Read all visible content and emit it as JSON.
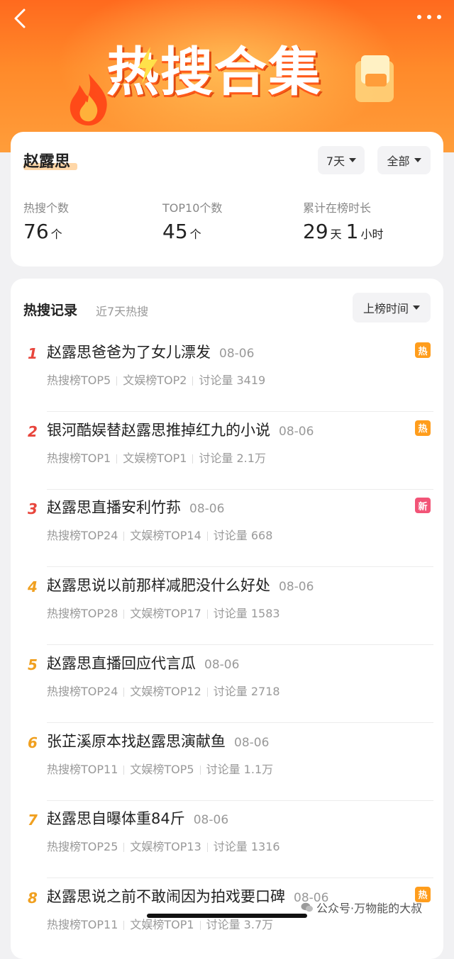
{
  "banner": {
    "title": "热搜合集"
  },
  "summary": {
    "name": "赵露思",
    "period_filter": "7天",
    "category_filter": "全部",
    "stats": [
      {
        "label": "热搜个数",
        "value": "76",
        "unit": "个"
      },
      {
        "label": "TOP10个数",
        "value": "45",
        "unit": "个"
      },
      {
        "label": "累计在榜时长",
        "value_days": "29",
        "unit_days": "天",
        "value_hours": "1",
        "unit_hours": "小时"
      }
    ]
  },
  "records": {
    "title": "热搜记录",
    "subtitle": "近7天热搜",
    "sort_label": "上榜时间",
    "items": [
      {
        "rank": "1",
        "title": "赵露思爸爸为了女儿漂发",
        "date": "08-06",
        "rank1": "热搜榜TOP5",
        "rank2": "文娱榜TOP2",
        "discussion": "讨论量 3419",
        "badge": "热"
      },
      {
        "rank": "2",
        "title": "银河酷娱替赵露思推掉红九的小说",
        "date": "08-06",
        "rank1": "热搜榜TOP1",
        "rank2": "文娱榜TOP1",
        "discussion": "讨论量 2.1万",
        "badge": "热"
      },
      {
        "rank": "3",
        "title": "赵露思直播安利竹荪",
        "date": "08-06",
        "rank1": "热搜榜TOP24",
        "rank2": "文娱榜TOP14",
        "discussion": "讨论量 668",
        "badge": "新"
      },
      {
        "rank": "4",
        "title": "赵露思说以前那样减肥没什么好处",
        "date": "08-06",
        "rank1": "热搜榜TOP28",
        "rank2": "文娱榜TOP17",
        "discussion": "讨论量 1583",
        "badge": ""
      },
      {
        "rank": "5",
        "title": "赵露思直播回应代言瓜",
        "date": "08-06",
        "rank1": "热搜榜TOP24",
        "rank2": "文娱榜TOP12",
        "discussion": "讨论量 2718",
        "badge": ""
      },
      {
        "rank": "6",
        "title": "张芷溪原本找赵露思演献鱼",
        "date": "08-06",
        "rank1": "热搜榜TOP11",
        "rank2": "文娱榜TOP5",
        "discussion": "讨论量 1.1万",
        "badge": ""
      },
      {
        "rank": "7",
        "title": "赵露思自曝体重84斤",
        "date": "08-06",
        "rank1": "热搜榜TOP25",
        "rank2": "文娱榜TOP13",
        "discussion": "讨论量 1316",
        "badge": ""
      },
      {
        "rank": "8",
        "title": "赵露思说之前不敢闹因为拍戏要口碑",
        "date": "08-06",
        "rank1": "热搜榜TOP11",
        "rank2": "文娱榜TOP1",
        "discussion": "讨论量 3.7万",
        "badge": "热"
      }
    ]
  },
  "watermark": {
    "text": "公众号·万物能的大叔"
  },
  "colors": {
    "rank_top": "#e8453c",
    "rank_other": "#f0a020",
    "badge_hot": "#ff9d1c",
    "badge_new": "#f25477",
    "banner": "#ff7a22"
  }
}
